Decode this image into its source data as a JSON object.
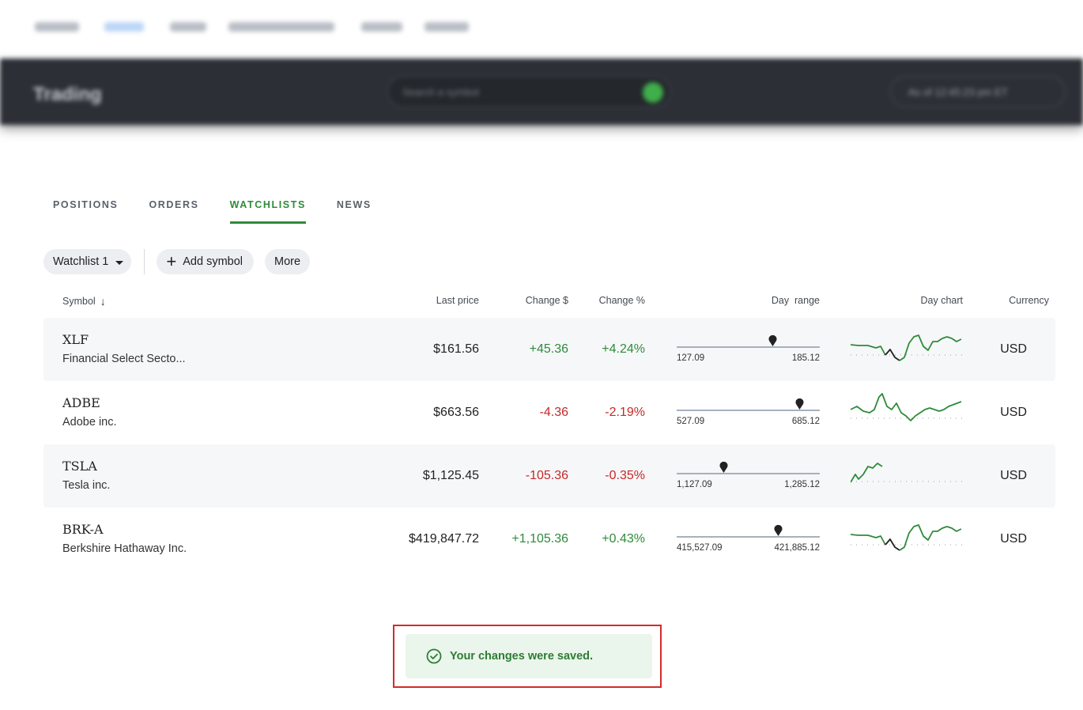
{
  "topnav": {
    "items": [
      "SUMMARY",
      "TRADING",
      "MOVERS",
      "ACCOUNT MANAGEMENT",
      "FUNDING",
      "REQUESTS"
    ]
  },
  "header": {
    "title": "Trading",
    "search_placeholder": "Search a symbol",
    "account_label": "As of 12:45:23 pm ET"
  },
  "tabs": [
    {
      "label": "POSITIONS"
    },
    {
      "label": "ORDERS"
    },
    {
      "label": "WATCHLISTS",
      "active": true
    },
    {
      "label": "NEWS"
    }
  ],
  "toolbar": {
    "watchlist_label": "Watchlist 1",
    "add_label": "Add symbol",
    "more_label": "More"
  },
  "table": {
    "headers": {
      "symbol": "Symbol",
      "last_price": "Last price",
      "change_dollar": "Change $",
      "change_pct": "Change %",
      "day_range": "Day  range",
      "day_chart": "Day chart",
      "currency": "Currency"
    },
    "rows": [
      {
        "ticker": "XLF",
        "name": "Financial Select Secto...",
        "last_price": "$161.56",
        "change_dollar": "+45.36",
        "change_pct": "+4.24%",
        "direction": "up",
        "range_low": "127.09",
        "range_high": "185.12",
        "range_position": 0.67,
        "currency": "USD"
      },
      {
        "ticker": "ADBE",
        "name": "Adobe inc.",
        "last_price": "$663.56",
        "change_dollar": "-4.36",
        "change_pct": "-2.19%",
        "direction": "down",
        "range_low": "527.09",
        "range_high": "685.12",
        "range_position": 0.86,
        "currency": "USD"
      },
      {
        "ticker": "TSLA",
        "name": "Tesla inc.",
        "last_price": "$1,125.45",
        "change_dollar": "-105.36",
        "change_pct": "-0.35%",
        "direction": "down",
        "range_low": "1,127.09",
        "range_high": "1,285.12",
        "range_position": 0.33,
        "currency": "USD"
      },
      {
        "ticker": "BRK-A",
        "name": "Berkshire Hathaway Inc.",
        "last_price": "$419,847.72",
        "change_dollar": "+1,105.36",
        "change_pct": "+0.43%",
        "direction": "up",
        "range_low": "415,527.09",
        "range_high": "421,885.12",
        "range_position": 0.71,
        "currency": "USD"
      }
    ]
  },
  "toast": {
    "message": "Your changes were saved."
  },
  "colors": {
    "accent_green": "#2e8b3a",
    "negative_red": "#c62828",
    "toast_bg": "#eaf5ec",
    "highlight_border": "#d42a2a"
  }
}
